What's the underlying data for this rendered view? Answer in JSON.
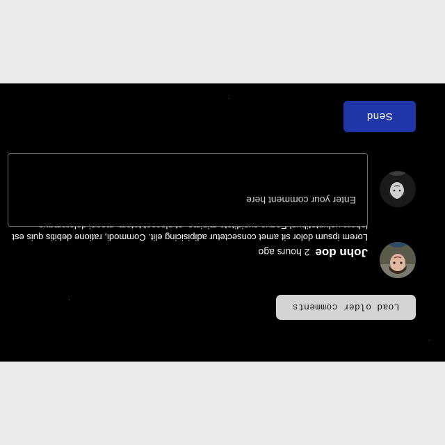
{
  "comments_section": {
    "load_older_label": "Load older comments",
    "comments": [
      {
        "author": "John doe",
        "time": "2 hours ago",
        "text": "Lorem ipsum dolor sit amet consectetur adipisicing elit. Commodi, ratione debitis quis est labore voluptatibus! Eaque cupiditate minima, at placeat totam, magni doloremque veniam neque porro libero rerum unde voluptatem!",
        "avatar_icon": "user-avatar"
      }
    ],
    "composer": {
      "placeholder": "Enter your comment here",
      "value": "",
      "avatar_icon": "current-user-avatar",
      "send_label": "Send"
    }
  },
  "colors": {
    "page_background": "#ebebeb",
    "panel_background": "#000000",
    "send_button": "#1f35a8",
    "load_button": "#d4d4d4",
    "input_border": "#6f6f6f"
  }
}
